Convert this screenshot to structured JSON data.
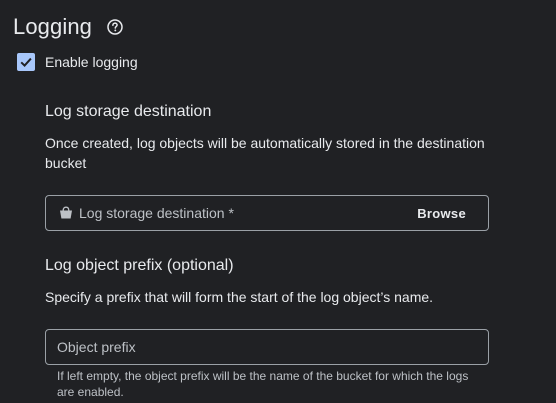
{
  "section": {
    "title": "Logging"
  },
  "enable_logging": {
    "label": "Enable logging",
    "checked": true
  },
  "log_storage": {
    "title": "Log storage destination",
    "description": "Once created, log objects will be automatically stored in the destination bucket",
    "field_label": "Log storage destination *",
    "browse_label": "Browse",
    "icon": "bucket-icon"
  },
  "log_prefix": {
    "title": "Log object prefix (optional)",
    "description": "Specify a prefix that will form the start of the log object’s name.",
    "input_value": "",
    "placeholder": "Object prefix",
    "hint": "If left empty, the object prefix will be the name of the bucket for which the logs are enabled."
  },
  "colors": {
    "background": "#202124",
    "text": "#e8eaed",
    "checkbox_fill": "#a8c7fa",
    "border": "#9aa0a6"
  }
}
